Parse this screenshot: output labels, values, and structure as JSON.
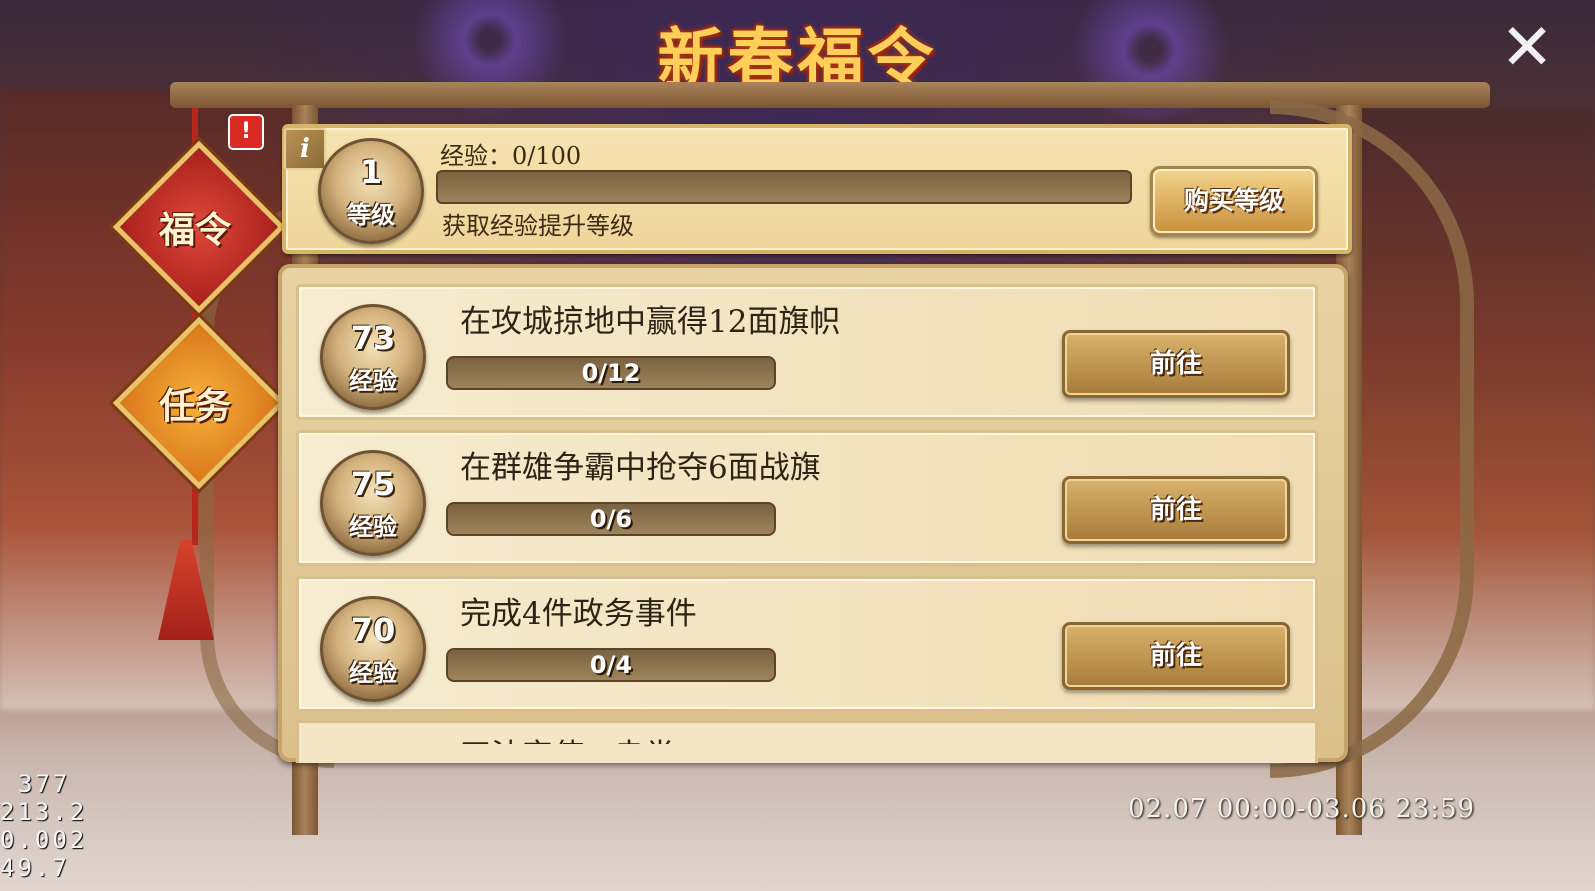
{
  "title": "新春福令",
  "tabs": [
    {
      "label": "福令"
    },
    {
      "label": "任务"
    }
  ],
  "alert_badge": "!",
  "info_icon": "i",
  "level": {
    "value": "1",
    "unit": "等级"
  },
  "experience": {
    "label": "经验：0/100",
    "progress": 0,
    "hint": "获取经验提升等级"
  },
  "buy_level_button": "购买等级",
  "tasks": [
    {
      "exp": "73",
      "exp_unit": "经验",
      "title": "在攻城掠地中赢得12面旗帜",
      "progress": "0/12",
      "button": "前往"
    },
    {
      "exp": "75",
      "exp_unit": "经验",
      "title": "在群雄争霸中抢夺6面战旗",
      "progress": "0/6",
      "button": "前往"
    },
    {
      "exp": "70",
      "exp_unit": "经验",
      "title": "完成4件政务事件",
      "progress": "0/4",
      "button": "前往"
    },
    {
      "title": "四法字使...赤尝"
    }
  ],
  "time_range": "02.07 00:00-03.06 23:59",
  "debug_stats": [
    "377",
    "213.2",
    "0.002",
    "49.7"
  ],
  "close_icon": "close-icon"
}
